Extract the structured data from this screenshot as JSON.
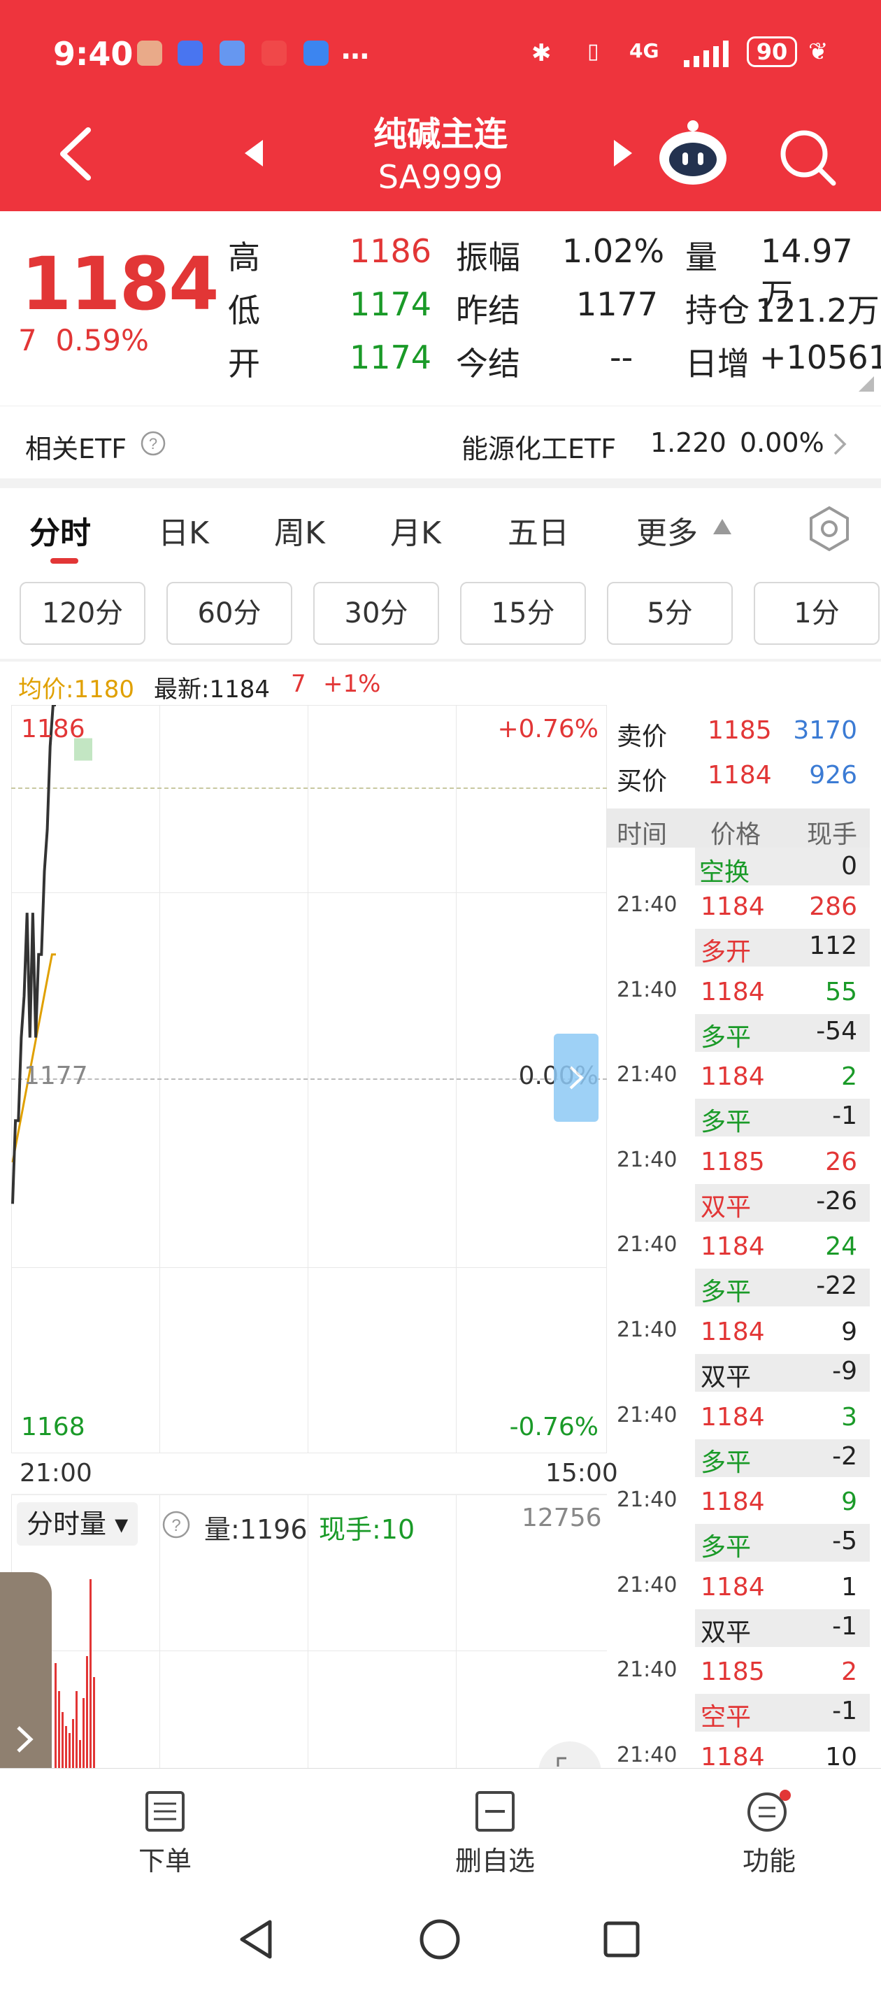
{
  "status": {
    "time": "9:40",
    "battery": "90",
    "network": "4G"
  },
  "header": {
    "title": "纯碱主连",
    "code": "SA9999"
  },
  "quote": {
    "price": "1184",
    "change": "7",
    "change_pct": "0.59%",
    "high_label": "高",
    "high": "1186",
    "low_label": "低",
    "low": "1174",
    "open_label": "开",
    "open": "1174",
    "amp_label": "振幅",
    "amp": "1.02%",
    "prev_settle_label": "昨结",
    "prev_settle": "1177",
    "settle_label": "今结",
    "settle": "--",
    "vol_label": "量",
    "vol": "14.97万",
    "oi_label": "持仓",
    "oi": "121.2万",
    "daily_inc_label": "日增",
    "daily_inc": "+10561"
  },
  "etf": {
    "label": "相关ETF",
    "name": "能源化工ETF",
    "price": "1.220",
    "pct": "0.00%"
  },
  "tabs": [
    "分时",
    "日K",
    "周K",
    "月K",
    "五日",
    "更多"
  ],
  "ranges": [
    "120分",
    "60分",
    "30分",
    "15分",
    "5分",
    "1分"
  ],
  "summary": {
    "avg": "均价:1180",
    "latest": "最新:1184",
    "chg": "7",
    "pct": "+1%"
  },
  "chart_data": {
    "type": "line",
    "y_top": "1186",
    "y_mid": "1177",
    "y_bottom": "1168",
    "pct_top": "+0.76%",
    "pct_mid": "0.00%",
    "pct_bottom": "-0.76%",
    "x_start": "21:00",
    "x_end": "15:00",
    "ylim": [
      1168,
      1186
    ],
    "price": [
      1174,
      1176,
      1176,
      1178,
      1179,
      1181,
      1178,
      1181,
      1178,
      1180,
      1180,
      1182,
      1183,
      1185,
      1186,
      1186
    ],
    "avg": [
      1175,
      1175.5,
      1176,
      1176.5,
      1177,
      1177.5,
      1178,
      1178.5,
      1179,
      1179.5,
      1180,
      1180
    ]
  },
  "vol_panel": {
    "label": "分时量",
    "vol": "量:1196",
    "hand": "现手:10",
    "max": "12756"
  },
  "orderbook": {
    "ask_label": "卖价",
    "ask": "1185",
    "ask_vol": "3170",
    "bid_label": "买价",
    "bid": "1184",
    "bid_vol": "926",
    "headers": [
      "时间",
      "价格",
      "现手"
    ],
    "first": {
      "type": "空换",
      "hand": "0"
    },
    "trades": [
      {
        "time": "21:40",
        "price": "1184",
        "vol": "286",
        "type": "多开",
        "hand": "112",
        "pc": "red",
        "tc": "red"
      },
      {
        "time": "21:40",
        "price": "1184",
        "vol": "55",
        "type": "多平",
        "hand": "-54",
        "pc": "red",
        "tc": "green"
      },
      {
        "time": "21:40",
        "price": "1184",
        "vol": "2",
        "type": "多平",
        "hand": "-1",
        "pc": "red",
        "tc": "green"
      },
      {
        "time": "21:40",
        "price": "1185",
        "vol": "26",
        "type": "双平",
        "hand": "-26",
        "pc": "red",
        "tc": "red"
      },
      {
        "time": "21:40",
        "price": "1184",
        "vol": "24",
        "type": "多平",
        "hand": "-22",
        "pc": "red",
        "tc": "green"
      },
      {
        "time": "21:40",
        "price": "1184",
        "vol": "9",
        "type": "双平",
        "hand": "-9",
        "pc": "red",
        "tc": "dark"
      },
      {
        "time": "21:40",
        "price": "1184",
        "vol": "3",
        "type": "多平",
        "hand": "-2",
        "pc": "red",
        "tc": "green"
      },
      {
        "time": "21:40",
        "price": "1184",
        "vol": "9",
        "type": "多平",
        "hand": "-5",
        "pc": "red",
        "tc": "green"
      },
      {
        "time": "21:40",
        "price": "1184",
        "vol": "1",
        "type": "双平",
        "hand": "-1",
        "pc": "red",
        "tc": "dark"
      },
      {
        "time": "21:40",
        "price": "1185",
        "vol": "2",
        "type": "空平",
        "hand": "-1",
        "pc": "red",
        "tc": "red"
      },
      {
        "time": "21:40",
        "price": "1184",
        "vol": "10",
        "type": "",
        "hand": "",
        "pc": "red",
        "tc": "dark"
      }
    ]
  },
  "bottom_nav": {
    "order": "下单",
    "delete": "删自选",
    "func": "功能"
  },
  "colors": {
    "red": "#e23636",
    "green": "#1a9a28",
    "blue": "#3b7bd4",
    "header": "#ee343d"
  }
}
